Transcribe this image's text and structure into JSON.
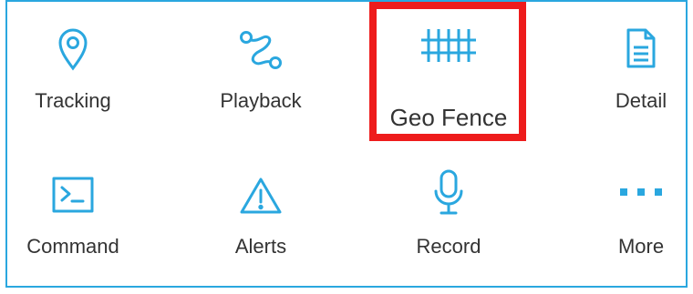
{
  "colors": {
    "border": "#2aa7df",
    "icon": "#2aa7df",
    "label": "#333333",
    "highlight": "#ee1c1c"
  },
  "menu": {
    "items": [
      {
        "label": "Tracking",
        "icon": "map-pin-icon"
      },
      {
        "label": "Playback",
        "icon": "route-icon"
      },
      {
        "label": "Geo Fence",
        "icon": "fence-icon",
        "highlighted": true
      },
      {
        "label": "Detail",
        "icon": "document-icon"
      },
      {
        "label": "Command",
        "icon": "terminal-icon"
      },
      {
        "label": "Alerts",
        "icon": "warning-icon"
      },
      {
        "label": "Record",
        "icon": "microphone-icon"
      },
      {
        "label": "More",
        "icon": "more-dots-icon"
      }
    ]
  }
}
